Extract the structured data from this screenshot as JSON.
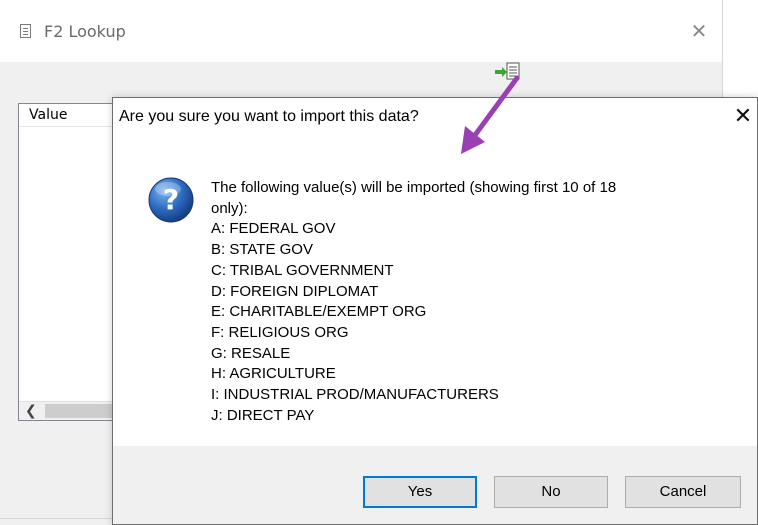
{
  "background_window": {
    "title": "F2 Lookup",
    "list_header": "Value"
  },
  "dialog": {
    "title": "Are you sure you want to import this data?",
    "message_lines": [
      "The following value(s) will be imported (showing first 10 of 18",
      "only):",
      "A: FEDERAL GOV",
      "B: STATE GOV",
      "C: TRIBAL GOVERNMENT",
      "D: FOREIGN DIPLOMAT",
      "E: CHARITABLE/EXEMPT ORG",
      "F: RELIGIOUS ORG",
      "G: RESALE",
      "H: AGRICULTURE",
      "I: INDUSTRIAL PROD/MANUFACTURERS",
      "J: DIRECT PAY"
    ],
    "buttons": {
      "yes": "Yes",
      "no": "No",
      "cancel": "Cancel"
    },
    "icon": "question-icon"
  },
  "colors": {
    "annotation_arrow": "#9b3fb5",
    "default_button_border": "#0078d7",
    "question_icon": "#1f5fb0"
  }
}
